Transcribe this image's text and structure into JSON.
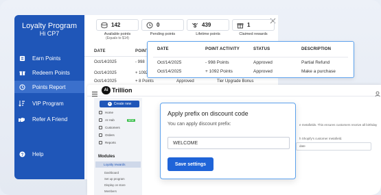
{
  "loyalty": {
    "title": "Loyalty Program",
    "subtitle": "Hi CP7",
    "nav": [
      {
        "label": "Earn Points",
        "icon": "earn-points-icon"
      },
      {
        "label": "Redeem Points",
        "icon": "gift-icon"
      },
      {
        "label": "Points Report",
        "icon": "clock-icon"
      },
      {
        "label": "VIP Program",
        "icon": "sort-icon"
      },
      {
        "label": "Refer A Friend",
        "icon": "handshake-icon"
      },
      {
        "label": "Help",
        "icon": "help-icon"
      }
    ]
  },
  "stats": [
    {
      "value": "142",
      "label": "Available points",
      "sublabel": "(Equals to $14)",
      "icon": "coins-icon"
    },
    {
      "value": "0",
      "label": "Pending points",
      "icon": "pending-coins-icon"
    },
    {
      "value": "439",
      "label": "Lifetime points",
      "icon": "dollar-icon"
    },
    {
      "value": "1",
      "label": "Claimed rewards",
      "icon": "reward-icon"
    }
  ],
  "report_table": {
    "headers": [
      "DATE",
      "POINT"
    ],
    "rows": [
      {
        "date": "Oct/14/2025",
        "points": "- 998"
      },
      {
        "date": "Oct/14/2025",
        "points": "+ 1092"
      },
      {
        "date": "Oct/14/2025",
        "points": "+ 8 Points",
        "status": "Approved",
        "description": "Tier Upgrade Bonus"
      }
    ]
  },
  "popup_table": {
    "headers": [
      "DATE",
      "POINT ACTIVITY",
      "STATUS",
      "DESCRIPTION"
    ],
    "rows": [
      [
        "Oct/14/2025",
        "- 998 Points",
        "Approved",
        "Partial Refund"
      ],
      [
        "Oct/14/2025",
        "+ 1092 Points",
        "Approved",
        "Make a purchase"
      ]
    ]
  },
  "aitrillion": {
    "logo_text": "Trillion",
    "logo_letter": "Ai",
    "create_button": "Create new",
    "menu": [
      "Home",
      "AI Hub",
      "Customers",
      "Orders",
      "Reports"
    ],
    "ai_badge": "NEW",
    "modules_heading": "Modules",
    "loyalty_rewards": "Loyalty rewards",
    "submenu": [
      "Dashboard",
      "Set up program",
      "Display on store",
      "Members"
    ],
    "right_text_1": "e metafields. This ensures customers receive all birthday",
    "right_text_2": "h Shopify's customer metafield.",
    "right_text_3": "date"
  },
  "dialog": {
    "title": "Apply prefix on discount code",
    "subtitle": "You can apply discount prefix:",
    "input_value": "WELCOME",
    "button": "Save settings"
  },
  "colors": {
    "brand": "#1f56b8",
    "button": "#1f64d8",
    "highlight_border": "#5aa0ec"
  }
}
